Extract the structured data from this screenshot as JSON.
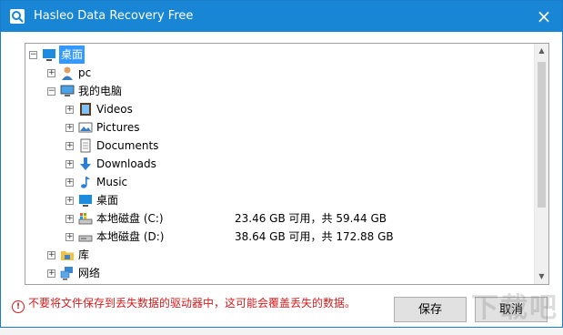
{
  "window": {
    "title": "Hasleo Data Recovery Free",
    "close_glyph": "×"
  },
  "tree": {
    "items": [
      {
        "label": "桌面",
        "icon": "desktop-icon",
        "expander": "−",
        "selected": true
      },
      {
        "label": "pc",
        "icon": "user-icon",
        "expander": "+"
      },
      {
        "label": "我的电脑",
        "icon": "computer-icon",
        "expander": "−"
      },
      {
        "label": "Videos",
        "icon": "videos-folder-icon",
        "expander": "+"
      },
      {
        "label": "Pictures",
        "icon": "pictures-folder-icon",
        "expander": "+"
      },
      {
        "label": "Documents",
        "icon": "documents-folder-icon",
        "expander": "+"
      },
      {
        "label": "Downloads",
        "icon": "downloads-folder-icon",
        "expander": "+"
      },
      {
        "label": "Music",
        "icon": "music-folder-icon",
        "expander": "+"
      },
      {
        "label": "桌面",
        "icon": "desktop-folder-icon",
        "expander": "+"
      },
      {
        "label": "本地磁盘 (C:)",
        "icon": "system-drive-icon",
        "expander": "+",
        "info": "23.46 GB 可用，共 59.44 GB"
      },
      {
        "label": "本地磁盘 (D:)",
        "icon": "drive-icon",
        "expander": "+",
        "info": "38.64 GB 可用，共 172.88 GB"
      },
      {
        "label": "库",
        "icon": "library-icon",
        "expander": "+"
      },
      {
        "label": "网络",
        "icon": "network-icon",
        "expander": "+"
      }
    ]
  },
  "scrollbar": {
    "up_glyph": "▲",
    "down_glyph": "▼"
  },
  "warning": {
    "icon_glyph": "!",
    "text": "不要将文件保存到丢失数据的驱动器中，这可能会覆盖丢失的数据。"
  },
  "buttons": {
    "save": "保存",
    "cancel": "取消"
  },
  "watermark": {
    "text": "下载吧"
  },
  "colors": {
    "titlebar": "#1886d4",
    "selection": "#3399ff",
    "warning": "#d11d1d"
  }
}
